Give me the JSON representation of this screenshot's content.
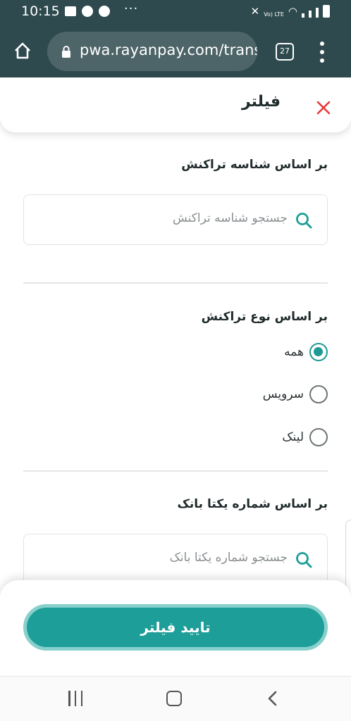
{
  "status_bar": {
    "time": "10:15",
    "overflow": "···",
    "network_label": "Vo) LTE"
  },
  "browser": {
    "url": "pwa.rayanpay.com/trans",
    "tab_count": "27"
  },
  "filter_panel": {
    "title": "فیلتر",
    "section_tx_id": {
      "label": "بر اساس شناسه تراکنش",
      "placeholder": "جستجو شناسه تراکنش"
    },
    "section_tx_type": {
      "label": "بر اساس نوع تراکنش",
      "options": [
        {
          "label": "همه",
          "checked": true
        },
        {
          "label": "سرویس",
          "checked": false
        },
        {
          "label": "لینک",
          "checked": false
        }
      ]
    },
    "section_bank_id": {
      "label": "بر اساس شماره یکتا بانک",
      "placeholder": "جستجو شماره یکتا بانک"
    },
    "confirm_label": "تایید فیلتر"
  },
  "colors": {
    "accent": "#1e9e99",
    "close": "#e53935",
    "topbar": "#2e4a4e"
  }
}
